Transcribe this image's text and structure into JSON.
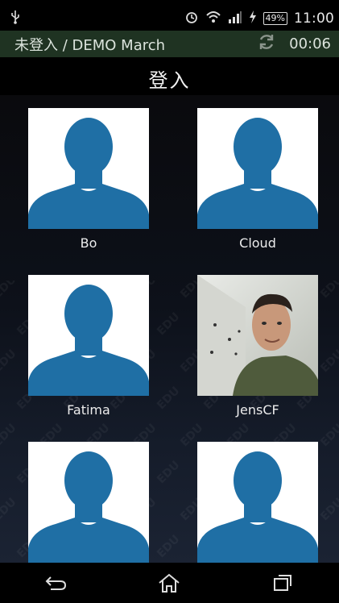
{
  "status_bar": {
    "icons": [
      "usb-icon",
      "alarm-icon",
      "wifi-icon",
      "signal-icon",
      "charging-icon"
    ],
    "battery": "49%",
    "time": "11:00"
  },
  "header": {
    "title": "未登入 / DEMO March",
    "timer": "00:06",
    "refresh_icon": "refresh-icon",
    "background": "#1f3322"
  },
  "page": {
    "title": "登入"
  },
  "users": [
    {
      "name": "Bo",
      "avatar": "placeholder-silhouette"
    },
    {
      "name": "Cloud",
      "avatar": "placeholder-silhouette"
    },
    {
      "name": "Fatima",
      "avatar": "placeholder-silhouette"
    },
    {
      "name": "JensCF",
      "avatar": "photo"
    },
    {
      "name": "",
      "avatar": "placeholder-silhouette"
    },
    {
      "name": "",
      "avatar": "placeholder-silhouette"
    }
  ],
  "watermark": "EDU",
  "colors": {
    "silhouette": "#1f6fa5",
    "card": "#ffffff"
  },
  "nav": {
    "back_icon": "back-icon",
    "home_icon": "home-icon",
    "recents_icon": "recents-icon"
  }
}
